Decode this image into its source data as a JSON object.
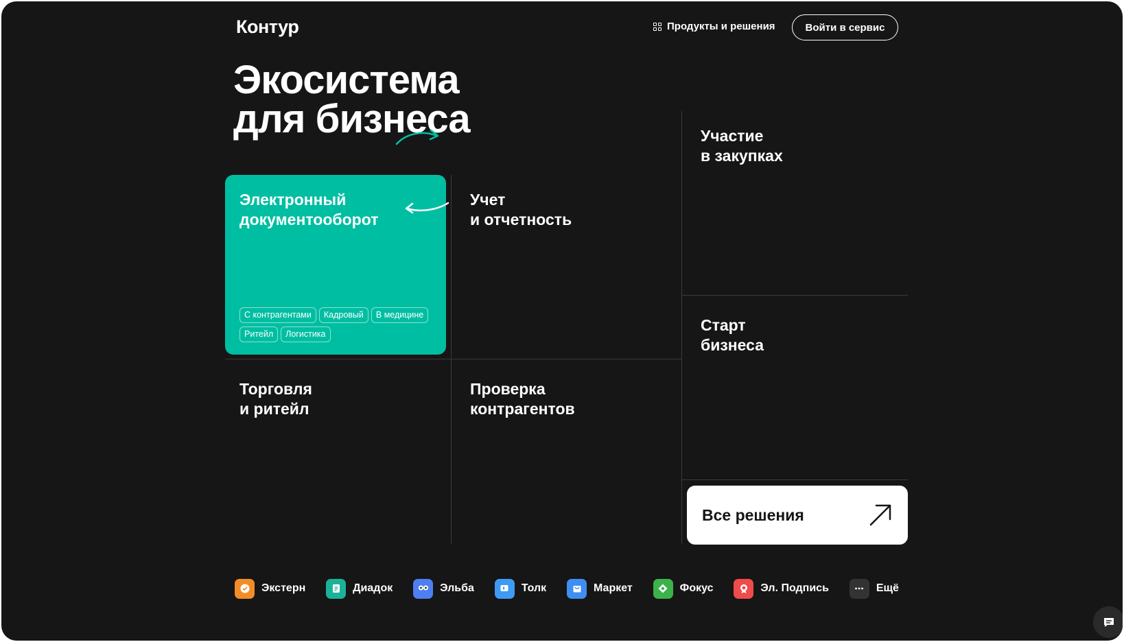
{
  "header": {
    "logo": "Контур",
    "products_label": "Продукты и решения",
    "login_label": "Войти в сервис"
  },
  "hero": {
    "line1": "Экосистема",
    "line2": "для бизнеса"
  },
  "tiles": {
    "edo": {
      "title": "Электронный\nдокументооборот",
      "tags": [
        "С контрагентами",
        "Кадровый",
        "В медицине",
        "Ритейл",
        "Логистика"
      ]
    },
    "accounting": {
      "title": "Учет\nи отчетность"
    },
    "procurement": {
      "title": "Участие\nв закупках"
    },
    "startup": {
      "title": "Старт\nбизнеса"
    },
    "retail": {
      "title": "Торговля\nи ритейл"
    },
    "check": {
      "title": "Проверка\nконтрагентов"
    }
  },
  "all_solutions": {
    "label": "Все решения"
  },
  "products": [
    {
      "name": "Экстерн",
      "icon": "extern-icon",
      "color": "#f28c28"
    },
    {
      "name": "Диадок",
      "icon": "diadoc-icon",
      "color": "#1ab39a"
    },
    {
      "name": "Эльба",
      "icon": "elba-icon",
      "color": "#4d7ef2"
    },
    {
      "name": "Толк",
      "icon": "tolk-icon",
      "color": "#3f9bf2"
    },
    {
      "name": "Маркет",
      "icon": "market-icon",
      "color": "#3f8ef2"
    },
    {
      "name": "Фокус",
      "icon": "focus-icon",
      "color": "#3bb34a"
    },
    {
      "name": "Эл. Подпись",
      "icon": "signature-icon",
      "color": "#ef4b4b"
    },
    {
      "name": "Ещё",
      "icon": "more-icon",
      "color": "#333333"
    }
  ],
  "colors": {
    "background": "#161616",
    "accent": "#00bea2",
    "divider": "#3a3a3a"
  }
}
